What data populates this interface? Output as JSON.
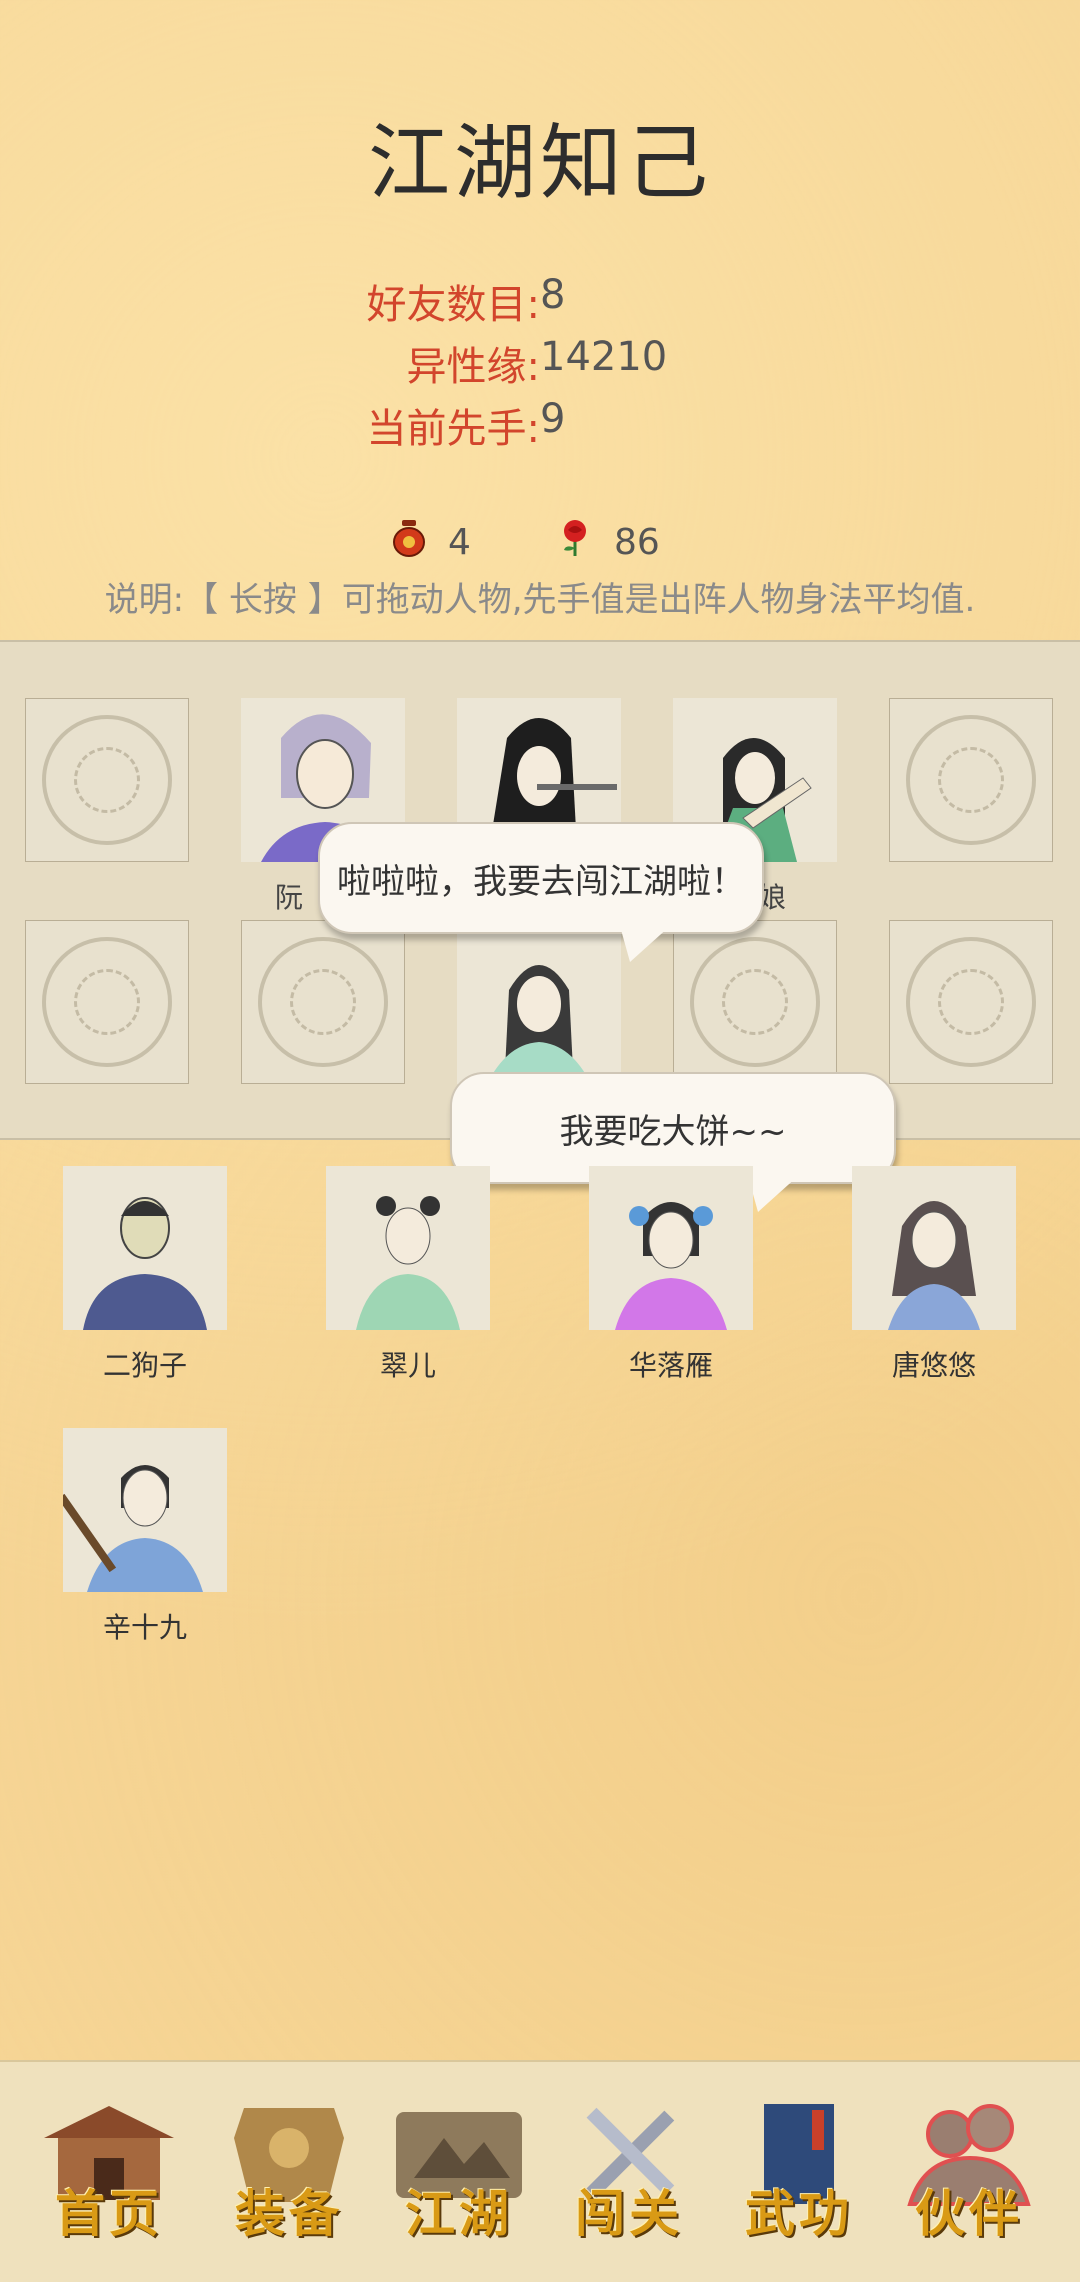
{
  "title": "江湖知己",
  "stats": {
    "friends_label": "好友数目:",
    "friends_value": "8",
    "charm_label": "异性缘:",
    "charm_value": "14210",
    "first_label": "当前先手:",
    "first_value": "9"
  },
  "resources": {
    "wine_count": "4",
    "rose_count": "86",
    "wine_icon": "wine-jar-icon",
    "rose_icon": "rose-icon"
  },
  "note": "说明:【 长按 】可拖动人物,先手值是出阵人物身法平均值.",
  "formation": {
    "row1": [
      {
        "type": "empty"
      },
      {
        "type": "hero",
        "name": "阮"
      },
      {
        "type": "hero",
        "name": ""
      },
      {
        "type": "hero",
        "name": "娘"
      },
      {
        "type": "empty"
      }
    ],
    "row2": [
      {
        "type": "empty"
      },
      {
        "type": "empty"
      },
      {
        "type": "hero",
        "name": ""
      },
      {
        "type": "empty"
      },
      {
        "type": "empty"
      }
    ]
  },
  "bubbles": {
    "bubble1": "啦啦啦，我要去闯江湖啦！",
    "bubble2": "我要吃大饼~~"
  },
  "roster": [
    {
      "name": "二狗子"
    },
    {
      "name": "翠儿"
    },
    {
      "name": "华落雁"
    },
    {
      "name": "唐悠悠"
    },
    {
      "name": "辛十九"
    }
  ],
  "nav": [
    {
      "label": "首页"
    },
    {
      "label": "装备"
    },
    {
      "label": "江湖"
    },
    {
      "label": "闯关"
    },
    {
      "label": "武功"
    },
    {
      "label": "伙伴"
    }
  ],
  "colors": {
    "accent_red": "#d2452c",
    "nav_gold": "#d99a15",
    "background": "#f6d595"
  }
}
